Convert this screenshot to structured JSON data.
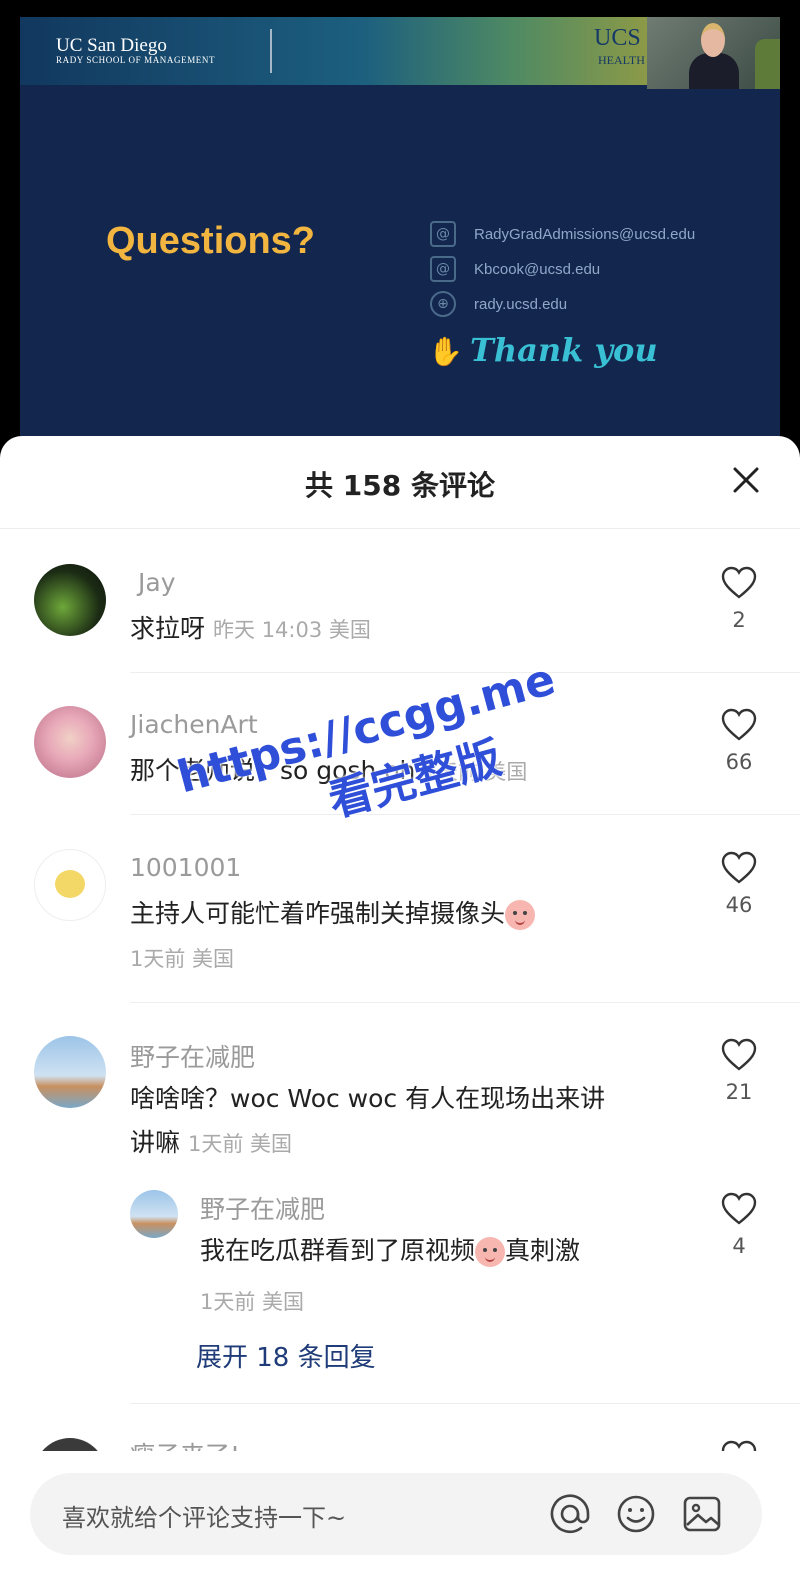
{
  "slide": {
    "university": "UC San Diego",
    "school": "RADY SCHOOL OF MANAGEMENT",
    "health_logo": "UCS",
    "health_sub": "HEALTH",
    "heading": "Questions?",
    "contacts": [
      {
        "icon": "mail-icon",
        "text": "RadyGradAdmissions@ucsd.edu"
      },
      {
        "icon": "mail-icon",
        "text": "Kbcook@ucsd.edu"
      },
      {
        "icon": "globe-icon",
        "text": "rady.ucsd.edu"
      }
    ],
    "thanks": "Thank you"
  },
  "sheet": {
    "title": "共 158 条评论"
  },
  "comments": [
    {
      "user": "Jay",
      "text": "求拉呀",
      "meta": "昨天 14:03 美国",
      "likes": "2"
    },
    {
      "user": "JiachenArt",
      "text": "那个老师说：so gosh oh",
      "meta": "1天前 美国",
      "likes": "66"
    },
    {
      "user": "1001001",
      "text": "主持人可能忙着咋强制关掉摄像头",
      "meta": "1天前 美国",
      "likes": "46"
    },
    {
      "user": "野子在减肥",
      "text_line1": "啥啥啥？woc Woc woc 有人在现场出来讲",
      "text_line2": "讲嘛",
      "meta": "1天前 美国",
      "likes": "21"
    },
    {
      "user": "野子在减肥",
      "text_a": "我在吃瓜群看到了原视频",
      "text_b": "真刺激",
      "meta": "1天前 美国",
      "likes": "4"
    }
  ],
  "expand_replies": "展开 18 条回复",
  "partial_user": "瘦子来了!",
  "watermark": {
    "line1": "https://ccgg.me",
    "line2": "看完整版"
  },
  "input": {
    "placeholder": "喜欢就给个评论支持一下~"
  }
}
